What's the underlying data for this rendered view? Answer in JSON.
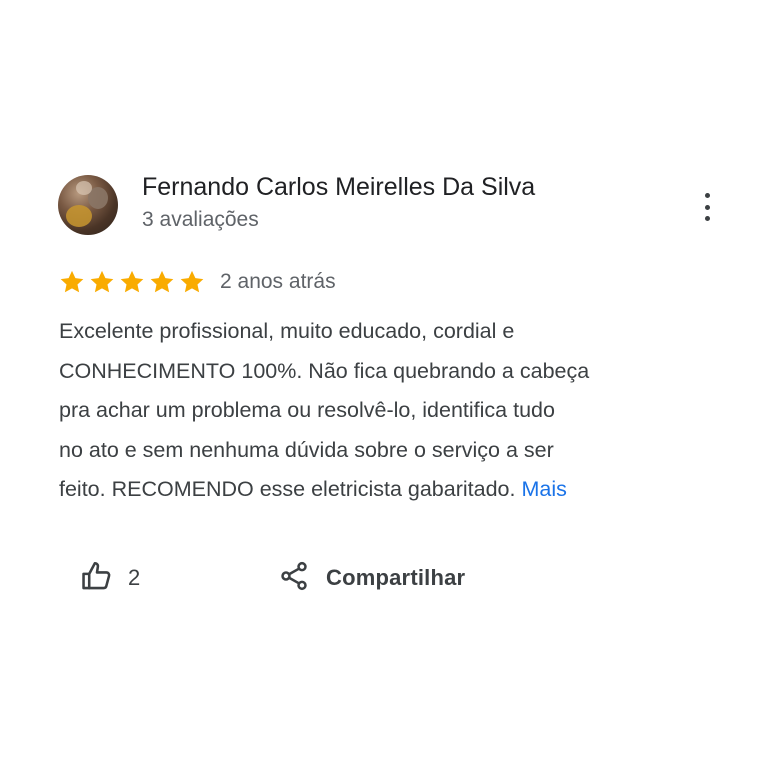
{
  "reviewer": {
    "name": "Fernando Carlos Meirelles Da Silva",
    "reviews_count": "3 avaliações"
  },
  "review": {
    "rating": 5,
    "max_rating": 5,
    "time_ago": "2 anos atrás",
    "text_lines": [
      "Excelente profissional, muito educado, cordial e",
      "CONHECIMENTO 100%. Não fica quebrando a cabeça",
      "pra achar um problema ou resolvê-lo, identifica tudo",
      "no ato e sem nenhuma dúvida sobre o serviço a ser",
      "feito. RECOMENDO esse eletricista gabaritado."
    ],
    "more_label": "Mais"
  },
  "actions": {
    "like_count": "2",
    "share_label": "Compartilhar"
  },
  "icons": {
    "star": "star-icon",
    "more": "more-vert-icon",
    "like": "thumb-up-icon",
    "share": "share-icon"
  },
  "colors": {
    "star": "#f9ab00",
    "link": "#1a73e8",
    "secondary_text": "#5f6368"
  }
}
